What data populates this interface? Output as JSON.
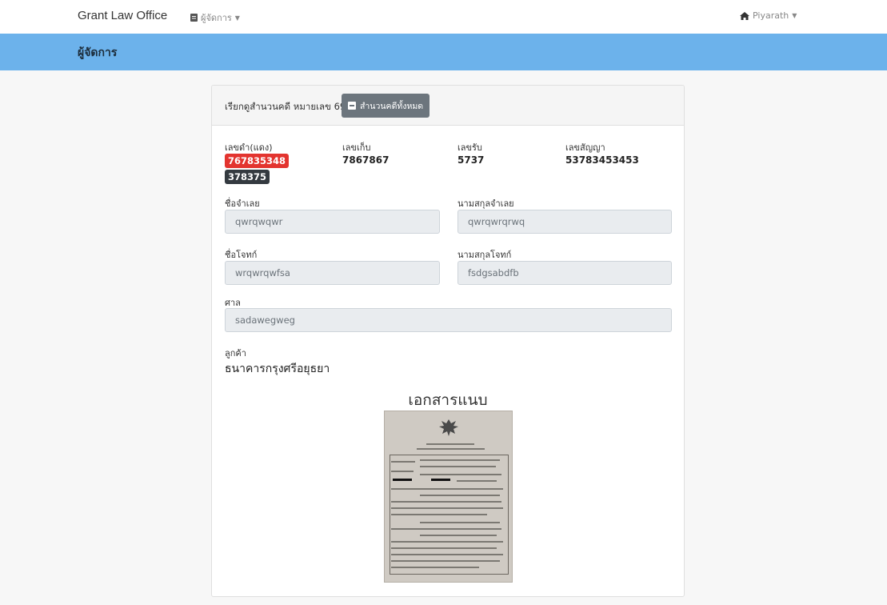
{
  "navbar": {
    "brand": "Grant Law Office",
    "menu_label": "ผู้จัดการ",
    "user_label": "Piyarath"
  },
  "header": {
    "title": "ผู้จัดการ"
  },
  "card": {
    "header_text": "เรียกดูสำนวนคดี หมายเลข 69",
    "all_cases_button": "สำนวนคดีทั้งหมด"
  },
  "info": {
    "red_number_label": "เลขดำ(แดง)",
    "red_number": "767835348",
    "black_number": "378375",
    "storage_label": "เลขเก็บ",
    "storage_value": "7867867",
    "receive_label": "เลขรับ",
    "receive_value": "5737",
    "contract_label": "เลขสัญญา",
    "contract_value": "53783453453"
  },
  "form": {
    "defendant_name_label": "ชื่อจำเลย",
    "defendant_name": "qwrqwqwr",
    "defendant_surname_label": "นามสกุลจำเลย",
    "defendant_surname": "qwrqwrqrwq",
    "plaintiff_name_label": "ชื่อโจทก์",
    "plaintiff_name": "wrqwrqwfsa",
    "plaintiff_surname_label": "นามสกุลโจทก์",
    "plaintiff_surname": "fsdgsabdfb",
    "court_label": "ศาล",
    "court": "sadawegweg"
  },
  "client": {
    "label": "ลูกค้า",
    "value": "ธนาคารกรุงศรีอยุธยา"
  },
  "attachments": {
    "title": "เอกสารแนบ"
  },
  "icons": {
    "menu": "document-icon",
    "user": "home-icon",
    "button": "list-icon"
  }
}
